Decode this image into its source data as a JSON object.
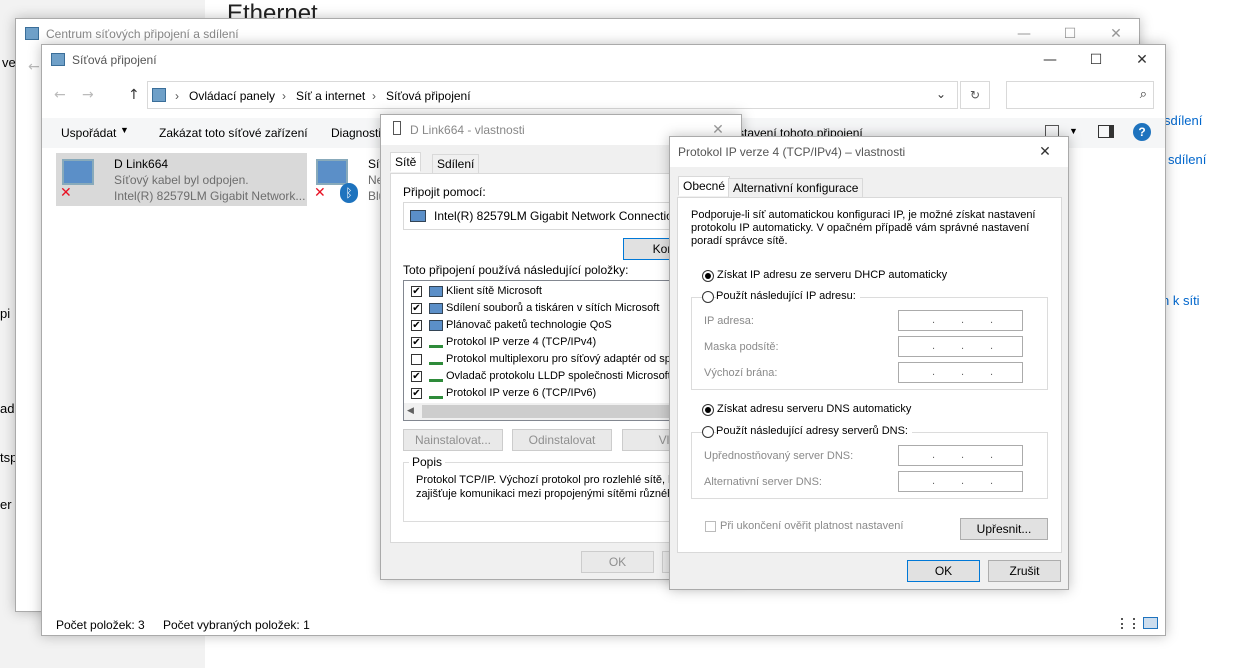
{
  "background": {
    "heading": "Ethernet",
    "right_links": [
      "sdílení",
      "sdílení",
      "n k síti"
    ],
    "left_fragments": [
      "ve",
      "pi",
      "adl",
      "tsp",
      "er"
    ]
  },
  "center_window": {
    "title": "Centrum síťových připojení a sdílení"
  },
  "explorer": {
    "title": "Síťová připojení",
    "address": {
      "crumbs": [
        "Ovládací panely",
        "Síť a internet",
        "Síťová připojení"
      ]
    },
    "toolbar": {
      "organize": "Uspořádat",
      "disable": "Zakázat toto síťové zařízení",
      "diagnose": "Diagnosti",
      "rename_tail": "stavení tohoto připojení"
    },
    "connections": [
      {
        "name": "D Link664",
        "status": "Síťový kabel byl odpojen.",
        "device": "Intel(R) 82579LM Gigabit Network..."
      },
      {
        "name": "Sít",
        "status": "Ne",
        "device": "Blu"
      }
    ],
    "status": {
      "count": "Počet položek: 3",
      "selected": "Počet vybraných položek: 1"
    }
  },
  "props": {
    "title": "D Link664 - vlastnosti",
    "tabs": [
      "Sítě",
      "Sdílení"
    ],
    "connect_label": "Připojit pomocí:",
    "adapter": "Intel(R) 82579LM Gigabit Network Connection",
    "configure": "Konfigu",
    "items_label": "Toto připojení používá následující položky:",
    "items": [
      {
        "label": "Klient sítě Microsoft",
        "checked": "✔"
      },
      {
        "label": "Sdílení souborů a tiskáren v sítích Microsoft",
        "checked": "✔"
      },
      {
        "label": "Plánovač paketů technologie QoS",
        "checked": "✔"
      },
      {
        "label": "Protokol IP verze 4 (TCP/IPv4)",
        "checked": "✔"
      },
      {
        "label": "Protokol multiplexoru pro síťový adaptér od spol",
        "checked": ""
      },
      {
        "label": "Ovladač protokolu LLDP společnosti Microsoft",
        "checked": "✔"
      },
      {
        "label": "Protokol IP verze 6 (TCP/IPv6)",
        "checked": "✔"
      }
    ],
    "install": "Nainstalovat...",
    "uninstall": "Odinstalovat",
    "properties": "Vlast",
    "desc_label": "Popis",
    "desc_line1": "Protokol TCP/IP. Výchozí protokol pro rozlehlé sítě, kt",
    "desc_line2": "zajišťuje komunikaci mezi propojenými sítěmi různého",
    "ok": "OK"
  },
  "ipv4": {
    "title": "Protokol IP verze 4 (TCP/IPv4) – vlastnosti",
    "tabs": [
      "Obecné",
      "Alternativní konfigurace"
    ],
    "intro1": "Podporuje-li síť automatickou konfiguraci IP, je možné získat nastavení",
    "intro2": "protokolu IP automaticky. V opačném případě vám správné nastavení",
    "intro3": "poradí správce sítě.",
    "ip_auto": "Získat IP adresu ze serveru DHCP automaticky",
    "ip_manual": "Použít následující IP adresu:",
    "ip_label": "IP adresa:",
    "mask_label": "Maska podsítě:",
    "gateway_label": "Výchozí brána:",
    "dns_auto": "Získat adresu serveru DNS automaticky",
    "dns_manual": "Použít následující adresy serverů DNS:",
    "dns_pref": "Upřednostňovaný server DNS:",
    "dns_alt": "Alternativní server DNS:",
    "dot": ".",
    "validate": "Při ukončení ověřit platnost nastavení",
    "advanced": "Upřesnit...",
    "ok": "OK",
    "cancel": "Zrušit"
  }
}
